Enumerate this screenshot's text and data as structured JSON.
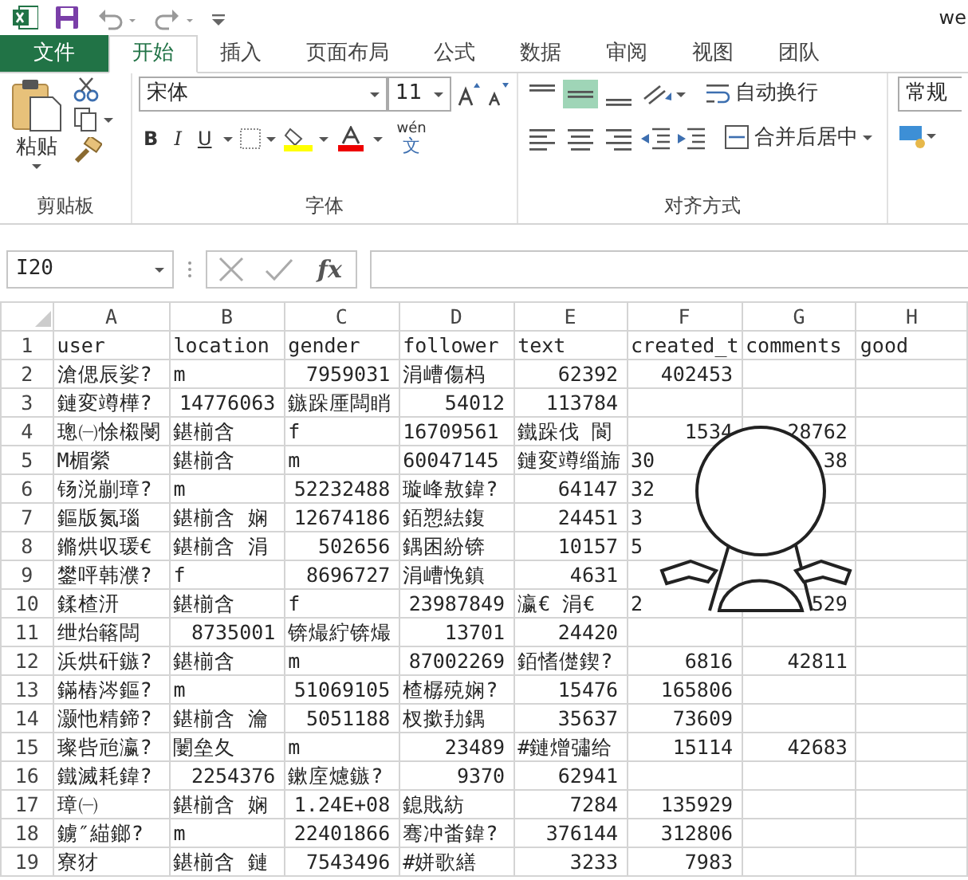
{
  "title_bar": {
    "title": "we"
  },
  "tabs": [
    {
      "label": "文件",
      "kind": "file",
      "selected": false
    },
    {
      "label": "开始",
      "kind": "tab",
      "selected": true
    },
    {
      "label": "插入",
      "kind": "tab",
      "selected": false
    },
    {
      "label": "页面布局",
      "kind": "tab",
      "selected": false
    },
    {
      "label": "公式",
      "kind": "tab",
      "selected": false
    },
    {
      "label": "数据",
      "kind": "tab",
      "selected": false
    },
    {
      "label": "审阅",
      "kind": "tab",
      "selected": false
    },
    {
      "label": "视图",
      "kind": "tab",
      "selected": false
    },
    {
      "label": "团队",
      "kind": "tab",
      "selected": false
    }
  ],
  "ribbon": {
    "clipboard": {
      "paste": "粘贴",
      "label": "剪贴板"
    },
    "font": {
      "name": "宋体",
      "size": "11",
      "bold": "B",
      "italic": "I",
      "underline": "U",
      "phonetic": "wén",
      "phonetic_char": "文",
      "label": "字体"
    },
    "alignment": {
      "wrap": "自动换行",
      "merge": "合并后居中",
      "label": "对齐方式"
    },
    "number": {
      "format": "常规"
    }
  },
  "formula_bar": {
    "name_box": "I20",
    "fx": "fx"
  },
  "columns": [
    "A",
    "B",
    "C",
    "D",
    "E",
    "F",
    "G",
    "H"
  ],
  "rows": [
    {
      "n": "1",
      "cells": [
        {
          "text": "user",
          "right": false
        },
        {
          "text": "location",
          "right": false
        },
        {
          "text": "gender",
          "right": false
        },
        {
          "text": "follower",
          "right": false
        },
        {
          "text": "text",
          "right": false
        },
        {
          "text": "created_t",
          "right": false
        },
        {
          "text": "comments",
          "right": false
        },
        {
          "text": "good",
          "right": false
        }
      ]
    },
    {
      "n": "2",
      "cells": [
        {
          "text": "滄偲辰娑?",
          "right": false
        },
        {
          "text": "m",
          "right": false
        },
        {
          "text": "7959031",
          "right": true
        },
        {
          "text": "涓嶆傷杩",
          "right": false
        },
        {
          "text": "62392",
          "right": true
        },
        {
          "text": "402453",
          "right": true
        },
        null,
        null
      ]
    },
    {
      "n": "3",
      "cells": [
        {
          "text": "鏈変竴樺?",
          "right": false
        },
        {
          "text": "14776063",
          "right": true
        },
        {
          "text": "鏃跺厜闆睄",
          "right": false
        },
        {
          "text": "54012",
          "right": true
        },
        {
          "text": "113784",
          "right": true
        },
        null,
        null,
        null
      ]
    },
    {
      "n": "4",
      "cells": [
        {
          "text": "璁㈠悇樧閿",
          "right": false
        },
        {
          "text": "鍖椾含",
          "right": false
        },
        {
          "text": "f",
          "right": false
        },
        {
          "text": "16709561",
          "right": false
        },
        {
          "text": "鐵跺伐 閬",
          "right": false
        },
        {
          "text": "1534",
          "right": true
        },
        {
          "text": "28762",
          "right": true
        },
        null
      ]
    },
    {
      "n": "5",
      "cells": [
        {
          "text": "M楣縈",
          "right": false
        },
        {
          "text": "鍖椾含",
          "right": false
        },
        {
          "text": "m",
          "right": false
        },
        {
          "text": "60047145",
          "right": false
        },
        {
          "text": "鏈変竴缁旆",
          "right": false
        },
        {
          "text": "30",
          "right": false
        },
        {
          "text": "38",
          "right": true
        },
        null
      ]
    },
    {
      "n": "6",
      "cells": [
        {
          "text": "钖涚剻璋?",
          "right": false
        },
        {
          "text": "m",
          "right": false
        },
        {
          "text": "52232488",
          "right": true
        },
        {
          "text": "璇峰敖鍏?",
          "right": false
        },
        {
          "text": "64147",
          "right": true
        },
        {
          "text": "32",
          "right": false
        },
        null,
        null
      ]
    },
    {
      "n": "7",
      "cells": [
        {
          "text": "鏂版氮瑙",
          "right": false
        },
        {
          "text": "鍖椾含 娴",
          "right": false
        },
        {
          "text": "12674186",
          "right": true
        },
        {
          "text": "銆愬紶鍑",
          "right": false
        },
        {
          "text": "24451",
          "right": true
        },
        {
          "text": "3",
          "right": false
        },
        null,
        null
      ]
    },
    {
      "n": "8",
      "cells": [
        {
          "text": "鏅烘収瑗€",
          "right": false
        },
        {
          "text": "鍖椾含 涓",
          "right": false
        },
        {
          "text": "502656",
          "right": true
        },
        {
          "text": "鍝困紛锛",
          "right": false
        },
        {
          "text": "10157",
          "right": true
        },
        {
          "text": "5",
          "right": false
        },
        null,
        null
      ]
    },
    {
      "n": "9",
      "cells": [
        {
          "text": "鐢呯韩濮?",
          "right": false
        },
        {
          "text": "f",
          "right": false
        },
        {
          "text": "8696727",
          "right": true
        },
        {
          "text": "涓嶆悗鎮",
          "right": false
        },
        {
          "text": "4631",
          "right": true
        },
        null,
        null,
        null
      ]
    },
    {
      "n": "10",
      "cells": [
        {
          "text": "鍒楂汧",
          "right": false
        },
        {
          "text": "鍖椾含",
          "right": false
        },
        {
          "text": "f",
          "right": false
        },
        {
          "text": "23987849",
          "right": true
        },
        {
          "text": "瀛€ 涓€",
          "right": false
        },
        {
          "text": "2",
          "right": false
        },
        {
          "text": "529",
          "right": true
        },
        null
      ]
    },
    {
      "n": "11",
      "cells": [
        {
          "text": "绁炲簵闆",
          "right": false
        },
        {
          "text": "8735001",
          "right": true
        },
        {
          "text": "锛熶紵锛熶",
          "right": false
        },
        {
          "text": "13701",
          "right": true
        },
        {
          "text": "24420",
          "right": true
        },
        null,
        null,
        null
      ]
    },
    {
      "n": "12",
      "cells": [
        {
          "text": "浜烘矸鏃?",
          "right": false
        },
        {
          "text": "鍖椾含",
          "right": false
        },
        {
          "text": "m",
          "right": false
        },
        {
          "text": "87002269",
          "right": true
        },
        {
          "text": "銆愭儊鍥?",
          "right": false
        },
        {
          "text": "6816",
          "right": true
        },
        {
          "text": "42811",
          "right": true
        },
        null
      ]
    },
    {
      "n": "13",
      "cells": [
        {
          "text": "鏋樁涔鏂?",
          "right": false
        },
        {
          "text": "m",
          "right": false
        },
        {
          "text": "51069105",
          "right": true
        },
        {
          "text": "楂樼殑娴?",
          "right": false
        },
        {
          "text": "15476",
          "right": true
        },
        {
          "text": "165806",
          "right": true
        },
        null,
        null
      ]
    },
    {
      "n": "14",
      "cells": [
        {
          "text": "灏忚精鍗?",
          "right": false
        },
        {
          "text": "鍖椾含 瀹",
          "right": false
        },
        {
          "text": "5051188",
          "right": true
        },
        {
          "text": "杈撳劧鍝",
          "right": false
        },
        {
          "text": "35637",
          "right": true
        },
        {
          "text": "73609",
          "right": true
        },
        null,
        null
      ]
    },
    {
      "n": "15",
      "cells": [
        {
          "text": "璨呰兘瀛?",
          "right": false
        },
        {
          "text": "闄垒夂",
          "right": false
        },
        {
          "text": "m",
          "right": false
        },
        {
          "text": "23489",
          "right": true
        },
        {
          "text": "#鏈熷彇给",
          "right": false
        },
        {
          "text": "15114",
          "right": true
        },
        {
          "text": "42683",
          "right": true
        },
        null
      ]
    },
    {
      "n": "16",
      "cells": [
        {
          "text": "鐵滅耗鍏?",
          "right": false
        },
        {
          "text": "2254376",
          "right": true
        },
        {
          "text": "鏉庢爈鏃?",
          "right": false
        },
        {
          "text": "9370",
          "right": true
        },
        {
          "text": "62941",
          "right": true
        },
        null,
        null,
        null
      ]
    },
    {
      "n": "17",
      "cells": [
        {
          "text": "璋㈠",
          "right": false
        },
        {
          "text": "鍖椾含 娴",
          "right": false
        },
        {
          "text": "1.24E+08",
          "right": true
        },
        {
          "text": "鎴戝紡",
          "right": false
        },
        {
          "text": "7284",
          "right": true
        },
        {
          "text": "135929",
          "right": true
        },
        null,
        null
      ]
    },
    {
      "n": "18",
      "cells": [
        {
          "text": "鐪″緢鎯?",
          "right": false
        },
        {
          "text": "m",
          "right": false
        },
        {
          "text": "22401866",
          "right": true
        },
        {
          "text": "骞冲畨鍏?",
          "right": false
        },
        {
          "text": "376144",
          "right": true
        },
        {
          "text": "312806",
          "right": true
        },
        null,
        null
      ]
    },
    {
      "n": "19",
      "cells": [
        {
          "text": "寮犲",
          "right": false
        },
        {
          "text": "鍖椾含 鏈",
          "right": false
        },
        {
          "text": "7543496",
          "right": true
        },
        {
          "text": "#姘歌繕",
          "right": false
        },
        {
          "text": "3233",
          "right": true
        },
        {
          "text": "7983",
          "right": true
        },
        null,
        null
      ]
    }
  ]
}
